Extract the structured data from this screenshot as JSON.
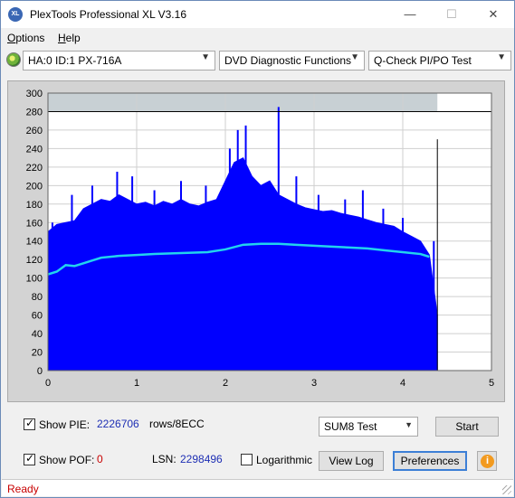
{
  "window": {
    "title": "PlexTools Professional XL V3.16",
    "app_icon_text": "XL",
    "min_glyph": "—",
    "max_glyph": "☐",
    "close_glyph": "✕"
  },
  "menu": [
    {
      "label": "Options",
      "underline": "O",
      "rest": "ptions"
    },
    {
      "label": "Help",
      "underline": "H",
      "rest": "elp"
    }
  ],
  "toolbar": {
    "drive": "HA:0 ID:1  PX-716A",
    "function": "DVD Diagnostic Functions",
    "test": "Q-Check PI/PO Test",
    "drive_icon": "disc-icon"
  },
  "chart_data": {
    "type": "bar",
    "xlim": [
      0,
      5
    ],
    "ylim": [
      0,
      300
    ],
    "x_ticks": [
      "0",
      "1",
      "2",
      "3",
      "4",
      "5"
    ],
    "y_ticks": [
      "0",
      "20",
      "40",
      "60",
      "80",
      "100",
      "120",
      "140",
      "160",
      "180",
      "200",
      "220",
      "240",
      "260",
      "280",
      "300"
    ],
    "reference_line_y": 280,
    "end_marker_x": 4.39,
    "end_marker_y": 250,
    "data_end_x": 4.39,
    "colors": {
      "bars": "#0000ff",
      "avg": "#22d3ee",
      "plot_bg": "#ffffff",
      "plot_shade": "#c8d0d4",
      "frame": "#d3d3d3"
    },
    "series": [
      {
        "name": "PIE",
        "x": [
          0.0,
          0.1,
          0.2,
          0.3,
          0.4,
          0.5,
          0.6,
          0.7,
          0.8,
          0.9,
          1.0,
          1.1,
          1.2,
          1.3,
          1.4,
          1.5,
          1.6,
          1.7,
          1.8,
          1.9,
          2.0,
          2.1,
          2.2,
          2.3,
          2.4,
          2.5,
          2.6,
          2.7,
          2.8,
          2.9,
          3.0,
          3.1,
          3.2,
          3.3,
          3.4,
          3.5,
          3.6,
          3.7,
          3.8,
          3.9,
          4.0,
          4.1,
          4.2,
          4.3,
          4.39
        ],
        "values": [
          150,
          158,
          160,
          162,
          175,
          180,
          185,
          183,
          190,
          185,
          180,
          182,
          178,
          183,
          180,
          185,
          180,
          178,
          182,
          185,
          205,
          225,
          230,
          210,
          200,
          205,
          190,
          185,
          180,
          176,
          174,
          172,
          173,
          170,
          168,
          166,
          163,
          160,
          158,
          156,
          150,
          145,
          140,
          125,
          60
        ]
      },
      {
        "name": "Average",
        "x": [
          0.0,
          0.1,
          0.2,
          0.3,
          0.4,
          0.5,
          0.6,
          0.8,
          1.0,
          1.2,
          1.5,
          1.8,
          2.0,
          2.2,
          2.4,
          2.6,
          2.8,
          3.0,
          3.2,
          3.4,
          3.6,
          3.8,
          4.0,
          4.2,
          4.3
        ],
        "values": [
          104,
          107,
          114,
          113,
          116,
          119,
          122,
          124,
          125,
          126,
          127,
          128,
          131,
          136,
          137,
          137,
          136,
          135,
          134,
          133,
          132,
          130,
          128,
          126,
          123
        ]
      },
      {
        "name": "Spikes",
        "x": [
          0.05,
          0.27,
          0.5,
          0.78,
          0.95,
          1.2,
          1.5,
          1.78,
          2.05,
          2.14,
          2.23,
          2.6,
          2.8,
          3.05,
          3.35,
          3.55,
          3.78,
          4.0,
          4.1,
          4.2,
          4.35
        ],
        "values": [
          160,
          190,
          200,
          215,
          210,
          195,
          205,
          200,
          240,
          260,
          265,
          285,
          210,
          190,
          185,
          195,
          175,
          165,
          145,
          135,
          140
        ]
      }
    ]
  },
  "bottom": {
    "show_pie_label": "Show PIE:",
    "pie_value": "2226706",
    "pie_unit": "rows/8ECC",
    "show_pof_label": "Show POF:",
    "pof_value": "0",
    "lsn_label": "LSN:",
    "lsn_value": "2298496",
    "log_label": "Logarithmic",
    "test_select": "SUM8 Test",
    "start_label": "Start",
    "viewlog_label": "View Log",
    "prefs_label": "Preferences",
    "info_glyph": "i"
  },
  "status": {
    "text": "Ready"
  }
}
